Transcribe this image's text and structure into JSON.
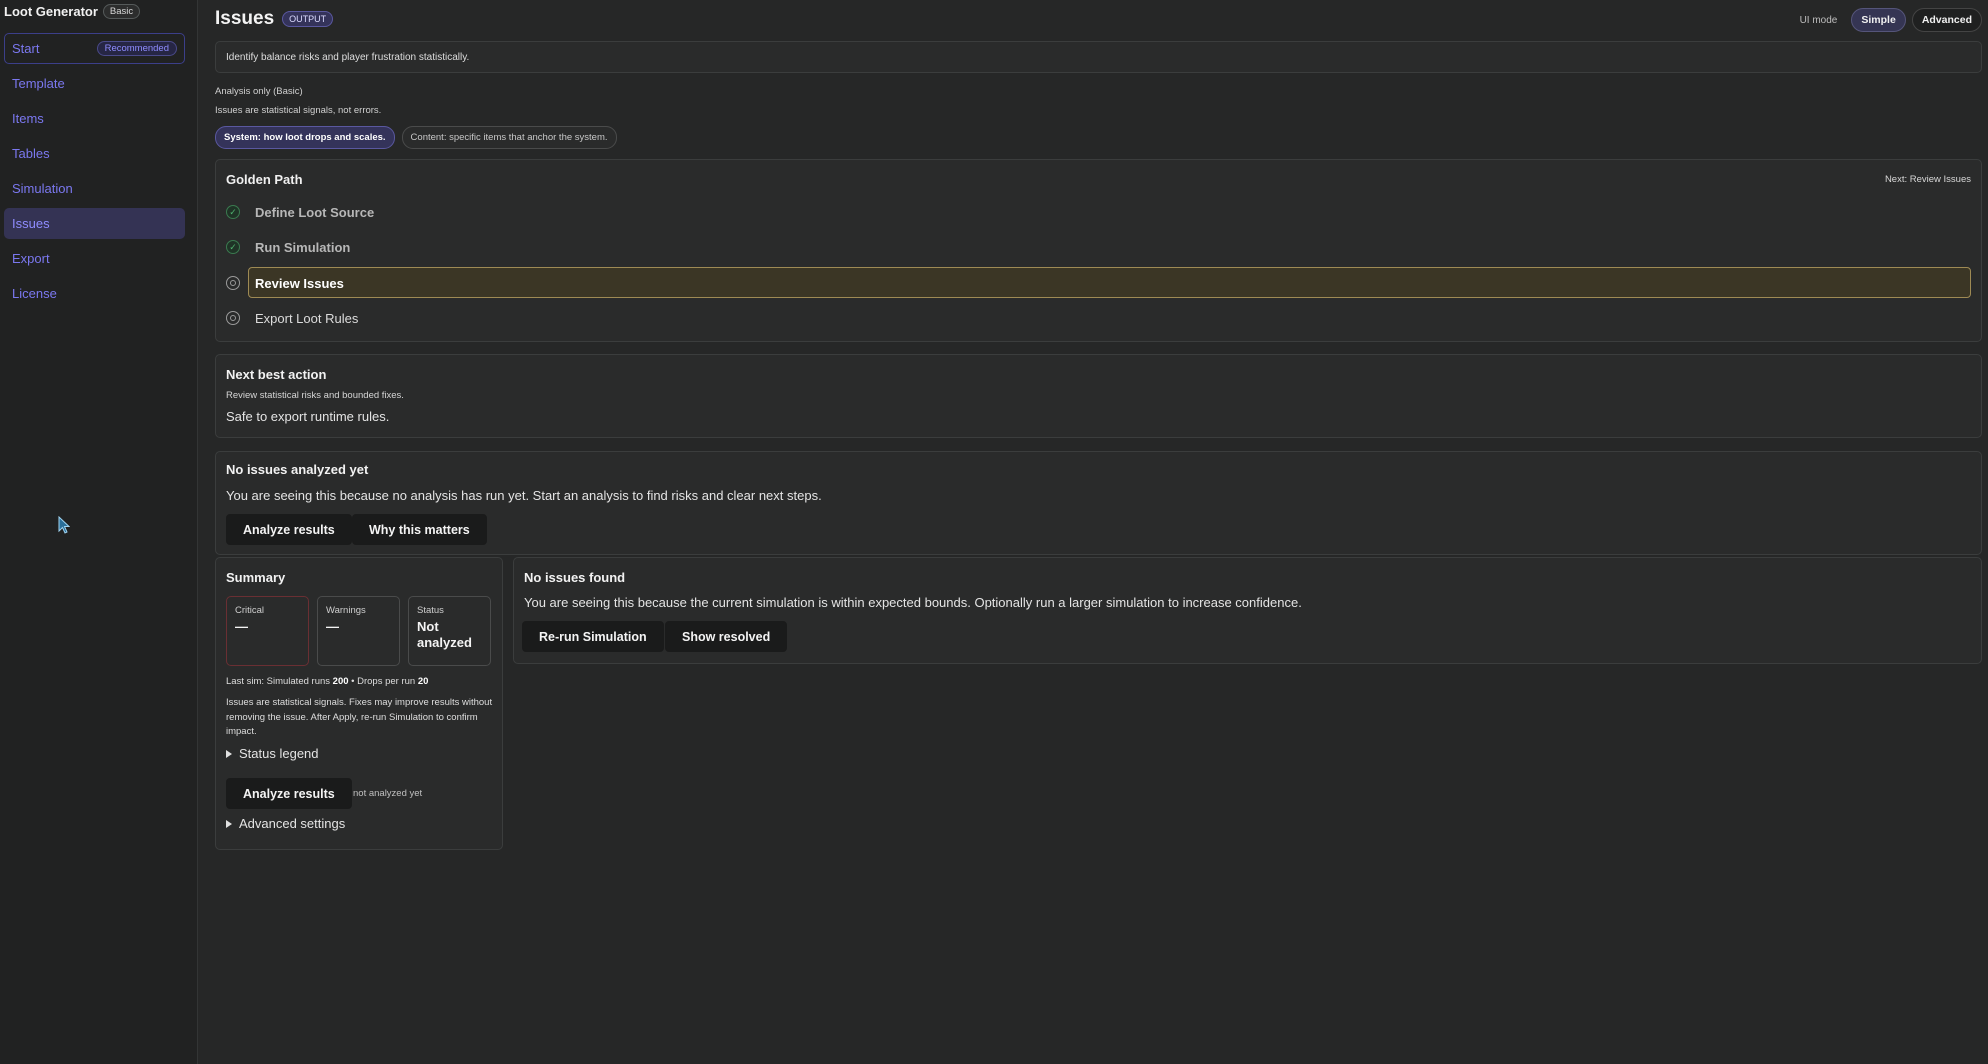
{
  "app": {
    "title": "Loot Generator",
    "tier_badge": "Basic"
  },
  "sidebar": {
    "items": [
      {
        "label": "Start",
        "badge": "Recommended"
      },
      {
        "label": "Template"
      },
      {
        "label": "Items"
      },
      {
        "label": "Tables"
      },
      {
        "label": "Simulation"
      },
      {
        "label": "Issues"
      },
      {
        "label": "Export"
      },
      {
        "label": "License"
      }
    ],
    "active": "Issues"
  },
  "header": {
    "title": "Issues",
    "badge": "OUTPUT",
    "ui_mode_label": "UI mode",
    "modes": [
      "Simple",
      "Advanced"
    ],
    "selected_mode": "Simple"
  },
  "intro": {
    "text": "Identify balance risks and player frustration statistically.",
    "analysis_mode": "Analysis only (Basic)",
    "note": "Issues are statistical signals, not errors.",
    "chips": [
      "System: how loot drops and scales.",
      "Content: specific items that anchor the system."
    ]
  },
  "golden_path": {
    "title": "Golden Path",
    "next": "Next: Review Issues",
    "steps": [
      {
        "label": "Define Loot Source",
        "status": "done"
      },
      {
        "label": "Run Simulation",
        "status": "done"
      },
      {
        "label": "Review Issues",
        "status": "current"
      },
      {
        "label": "Export Loot Rules",
        "status": "todo"
      }
    ],
    "done_glyph": "✓"
  },
  "next_best_action": {
    "title": "Next best action",
    "subtitle": "Review statistical risks and bounded fixes.",
    "body": "Safe to export runtime rules."
  },
  "no_issues_analyzed": {
    "title": "No issues analyzed yet",
    "body": "You are seeing this because no analysis has run yet. Start an analysis to find risks and clear next steps.",
    "analyze_label": "Analyze results",
    "why_label": "Why this matters"
  },
  "summary": {
    "title": "Summary",
    "stats": [
      {
        "label": "Critical",
        "value": "—"
      },
      {
        "label": "Warnings",
        "value": "—"
      },
      {
        "label": "Status",
        "value": "Not analyzed"
      }
    ],
    "last_sim_prefix": "Last sim: Simulated runs ",
    "runs": "200",
    "drops_prefix": " • Drops per run ",
    "drops": "20",
    "paragraph": "Issues are statistical signals. Fixes may improve results without removing the issue. After Apply, re-run Simulation to confirm impact.",
    "status_legend": "Status legend",
    "analyze_label": "Analyze results",
    "analyze_note": "not analyzed yet",
    "advanced_settings": "Advanced settings"
  },
  "no_issues_found": {
    "title": "No issues found",
    "body": "You are seeing this because the current simulation is within expected bounds. Optionally run a larger simulation to increase confidence.",
    "rerun_label": "Re-run Simulation",
    "resolved_label": "Show resolved"
  },
  "colors": {
    "accent": "#7b78f0",
    "background": "#262727",
    "current_step": "#9e8a54",
    "done": "#4fb06e"
  }
}
